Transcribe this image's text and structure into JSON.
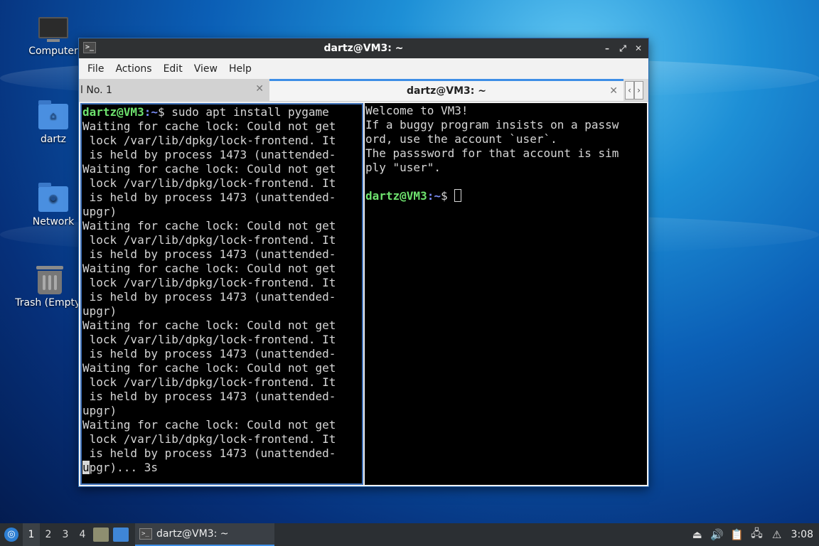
{
  "desktop": {
    "icons": [
      {
        "label": "Computer"
      },
      {
        "label": "dartz"
      },
      {
        "label": "Network"
      },
      {
        "label": "Trash (Empty)"
      }
    ]
  },
  "window": {
    "title": "dartz@VM3: ~",
    "menu": [
      "File",
      "Actions",
      "Edit",
      "View",
      "Help"
    ],
    "tabs": [
      {
        "label": "l No. 1",
        "active": false
      },
      {
        "label": "dartz@VM3: ~",
        "active": true
      }
    ],
    "left_pane": {
      "prompt_user": "dartz@VM3",
      "prompt_path": "~",
      "command": "sudo apt install pygame",
      "lines": [
        "Waiting for cache lock: Could not get",
        " lock /var/lib/dpkg/lock-frontend. It",
        " is held by process 1473 (unattended-",
        "Waiting for cache lock: Could not get",
        " lock /var/lib/dpkg/lock-frontend. It",
        " is held by process 1473 (unattended-",
        "upgr)",
        "Waiting for cache lock: Could not get",
        " lock /var/lib/dpkg/lock-frontend. It",
        " is held by process 1473 (unattended-",
        "Waiting for cache lock: Could not get",
        " lock /var/lib/dpkg/lock-frontend. It",
        " is held by process 1473 (unattended-",
        "upgr)",
        "Waiting for cache lock: Could not get",
        " lock /var/lib/dpkg/lock-frontend. It",
        " is held by process 1473 (unattended-",
        "Waiting for cache lock: Could not get",
        " lock /var/lib/dpkg/lock-frontend. It",
        " is held by process 1473 (unattended-",
        "upgr)",
        "Waiting for cache lock: Could not get",
        " lock /var/lib/dpkg/lock-frontend. It",
        " is held by process 1473 (unattended-"
      ],
      "last_line_cursor_char": "u",
      "last_line_rest": "pgr)... 3s"
    },
    "right_pane": {
      "lines": [
        "Welcome to VM3!",
        "If a buggy program insists on a passw",
        "ord, use the account `user`.",
        "The passsword for that account is sim",
        "ply \"user\".",
        ""
      ],
      "prompt_user": "dartz@VM3",
      "prompt_path": "~"
    }
  },
  "taskbar": {
    "workspaces": [
      "1",
      "2",
      "3",
      "4"
    ],
    "active_workspace": "1",
    "task_label": "dartz@VM3: ~",
    "clock": "3:08"
  },
  "colors": {
    "prompt_user": "#6ee26e",
    "prompt_path": "#7a8cf5",
    "accent": "#3d8ee6"
  }
}
